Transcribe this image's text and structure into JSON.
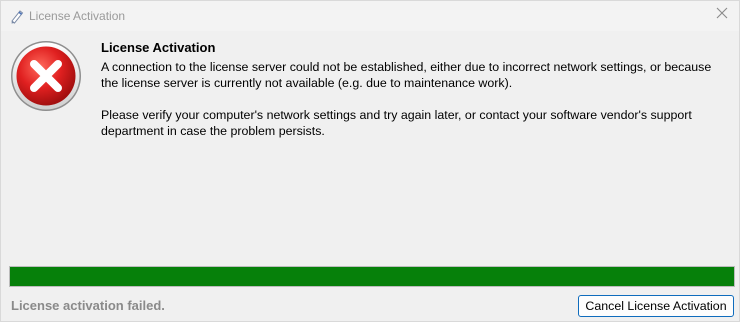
{
  "window": {
    "title": "License Activation",
    "app_icon": "pen-icon",
    "close_icon": "close-icon"
  },
  "dialog": {
    "icon": "error-icon",
    "heading": "License Activation",
    "paragraph1": "A connection to the license server could not be established, either due to incorrect network settings, or because the license server is currently not available (e.g. due to maintenance work).",
    "paragraph2": "Please verify your computer's network settings and try again later, or contact your software vendor's support department in case the problem persists."
  },
  "progress": {
    "value": 1.0,
    "color": "#06800a"
  },
  "footer": {
    "status": "License activation failed.",
    "cancel_label": "Cancel License Activation"
  },
  "colors": {
    "error_red": "#e02020",
    "accent_blue": "#0f6cbd"
  }
}
